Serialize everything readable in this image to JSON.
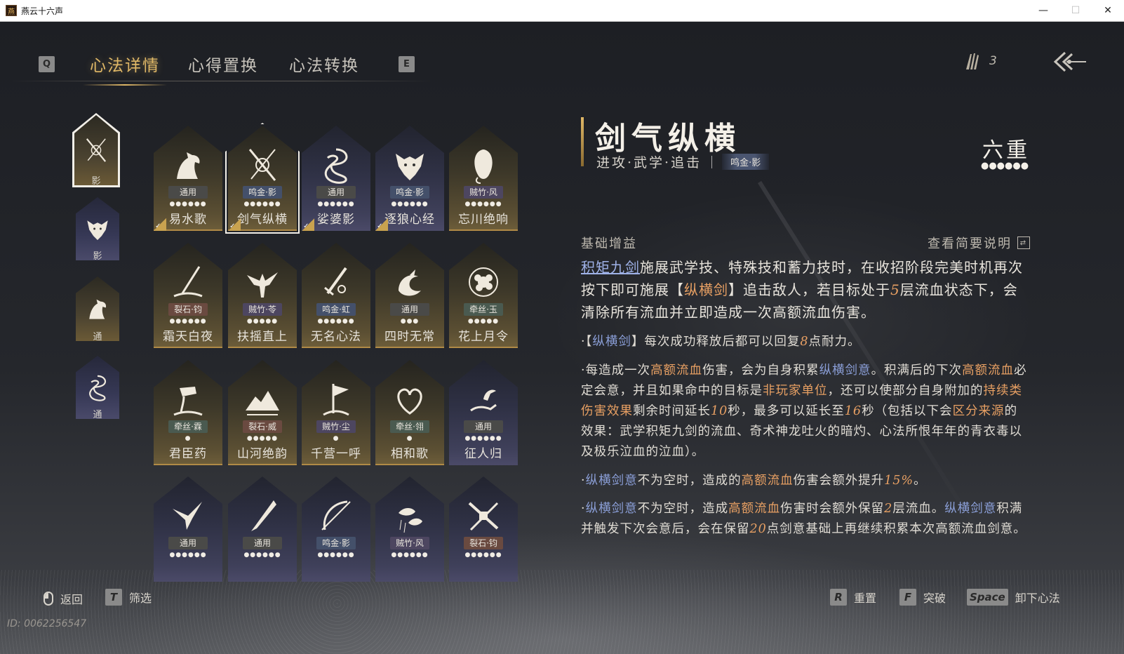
{
  "window": {
    "title": "燕云十六声",
    "app_icon": "燕",
    "minimize": "—",
    "maximize": "☐",
    "close": "✕"
  },
  "tabs": {
    "left_key": "Q",
    "right_key": "E",
    "items": [
      {
        "label": "心法详情",
        "active": true
      },
      {
        "label": "心得置换",
        "active": false
      },
      {
        "label": "心法转换",
        "active": false
      }
    ]
  },
  "currency": {
    "icon": "feather-token-icon",
    "count": "3"
  },
  "categories": [
    {
      "icon": "crossed-swords-icon",
      "label": "影",
      "style": "gold",
      "selected": true
    },
    {
      "icon": "wolf-icon",
      "label": "影",
      "style": "purple",
      "selected": false
    },
    {
      "icon": "horse-icon",
      "label": "通",
      "style": "gold",
      "selected": false
    },
    {
      "icon": "dragon-icon",
      "label": "通",
      "style": "purple",
      "selected": false
    }
  ],
  "cards": [
    {
      "name": "易水歌",
      "tag": "通用",
      "tag_color": "#4a4a48",
      "dots": "●●●●●●",
      "style": "gold",
      "icon": "horse-icon",
      "equipped": true
    },
    {
      "name": "剑气纵横",
      "tag": "鸣金·影",
      "tag_color": "#44506a",
      "dots": "●●●●●●",
      "style": "gold",
      "icon": "crossed-swords-icon",
      "equipped": true,
      "selected": true
    },
    {
      "name": "娑婆影",
      "tag": "通用",
      "tag_color": "#4a4a48",
      "dots": "●●●●●●",
      "style": "purple",
      "icon": "dragon-icon",
      "equipped": true
    },
    {
      "name": "逐狼心经",
      "tag": "鸣金·影",
      "tag_color": "#44506a",
      "dots": "●●●●●●",
      "style": "purple",
      "icon": "wolf-icon",
      "equipped": true
    },
    {
      "name": "忘川绝响",
      "tag": "贼竹·风",
      "tag_color": "#4d4660",
      "dots": "●●●●●●",
      "style": "gold",
      "icon": "mask-icon",
      "equipped": false
    },
    {
      "name": "霜天白夜",
      "tag": "裂石·钧",
      "tag_color": "#6a4a40",
      "dots": "●●●●●●",
      "style": "gold",
      "icon": "spear-icon",
      "equipped": false
    },
    {
      "name": "扶摇直上",
      "tag": "贼竹·苓",
      "tag_color": "#4d4660",
      "dots": "●●●●●",
      "style": "gold",
      "icon": "eagle-icon",
      "equipped": false
    },
    {
      "name": "无名心法",
      "tag": "鸣金·虹",
      "tag_color": "#44506a",
      "dots": "●●●●●●",
      "style": "gold",
      "icon": "sword-icon",
      "equipped": false
    },
    {
      "name": "四时无常",
      "tag": "通用",
      "tag_color": "#4a4a48",
      "dots": "●●●",
      "style": "gold",
      "icon": "bird-moon-icon",
      "equipped": false
    },
    {
      "name": "花上月令",
      "tag": "牵丝·玉",
      "tag_color": "#4a5a50",
      "dots": "●●●●●",
      "style": "gold",
      "icon": "flower-icon",
      "equipped": false
    },
    {
      "name": "君臣药",
      "tag": "牵丝·霖",
      "tag_color": "#4a5a50",
      "dots": "●",
      "style": "gold",
      "icon": "pouring-jar-icon",
      "equipped": false
    },
    {
      "name": "山河绝韵",
      "tag": "裂石·威",
      "tag_color": "#6a4a40",
      "dots": "●●●●●",
      "style": "gold",
      "icon": "mountain-icon",
      "equipped": false
    },
    {
      "name": "千营一呼",
      "tag": "贼竹·尘",
      "tag_color": "#4d4660",
      "dots": "●",
      "style": "gold",
      "icon": "flag-icon",
      "equipped": false
    },
    {
      "name": "相和歌",
      "tag": "牵丝·翎",
      "tag_color": "#4a5a50",
      "dots": "●",
      "style": "gold",
      "icon": "heart-birds-icon",
      "equipped": false
    },
    {
      "name": "征人归",
      "tag": "通用",
      "tag_color": "#4a4a48",
      "dots": "●●●●●●",
      "style": "purple",
      "icon": "hand-bird-icon",
      "equipped": false
    },
    {
      "name": "",
      "tag": "通用",
      "tag_color": "#4a4a48",
      "dots": "●●●●●●",
      "style": "purple",
      "icon": "swallow-icon",
      "equipped": false
    },
    {
      "name": "",
      "tag": "通用",
      "tag_color": "#4a4a48",
      "dots": "●●●●●●",
      "style": "purple",
      "icon": "brush-blade-icon",
      "equipped": false
    },
    {
      "name": "",
      "tag": "鸣金·影",
      "tag_color": "#44506a",
      "dots": "●●●●●●",
      "style": "purple",
      "icon": "bow-icon",
      "equipped": false
    },
    {
      "name": "",
      "tag": "贼竹·风",
      "tag_color": "#4d4660",
      "dots": "●●●●●●",
      "style": "purple",
      "icon": "fish-rain-icon",
      "equipped": false
    },
    {
      "name": "",
      "tag": "裂石·钧",
      "tag_color": "#6a4a40",
      "dots": "●●●●●●",
      "style": "purple",
      "icon": "crossed-blades-icon",
      "equipped": false
    }
  ],
  "detail": {
    "title": "剑气纵横",
    "subtitle": "进攻·武学·追击",
    "tag": "鸣金·影",
    "level": "六重",
    "level_dots": "●●●●●●",
    "section_label": "基础增益",
    "view_brief": "查看简要说明",
    "main": {
      "link": "积矩九剑",
      "text1": "施展武学技、特殊技和蓄力技时，在收招阶段完美时机再次按下即可施展【",
      "kw1": "纵横剑",
      "text2": "】追击敌人，若目标处于",
      "num1": "5",
      "text3": "层流血状态下，会清除所有流血并立即造成一次高额流血伤害。"
    },
    "p1": {
      "a": "·【",
      "kw": "纵横剑",
      "b": "】每次成功释放后都可以回复",
      "num": "8",
      "c": "点耐力。"
    },
    "p2": {
      "a": "·每造成一次",
      "kw1": "高额流血",
      "b": "伤害，会为自身积累",
      "kw2": "纵横剑意",
      "c": "。积满后的下次",
      "kw3": "高额流血",
      "d": "必定会意，并且如果命中的目标是",
      "kw4": "非玩家单位",
      "e": "，还可以使部分自身附加的",
      "kw5": "持续类伤害效果",
      "f": "剩余时间延长",
      "num1": "10",
      "g": "秒，最多可以延长至",
      "num2": "16",
      "h": "秒（包括以下会",
      "kw6": "区分来源",
      "i": "的效果：武学积矩九剑的流血、奇术神龙吐火的暗灼、心法所恨年年的青衣毒以及极乐泣血的泣血）。"
    },
    "p3": {
      "a": "·",
      "kw1": "纵横剑意",
      "b": "不为空时，造成的",
      "kw2": "高额流血",
      "c": "伤害会额外提升",
      "num": "15%",
      "d": "。"
    },
    "p4": {
      "a": "·",
      "kw1": "纵横剑意",
      "b": "不为空时，造成",
      "kw2": "高额流血",
      "c": "伤害时会额外保留",
      "num1": "2",
      "d": "层流血。",
      "kw3": "纵横剑意",
      "e": "积满并触发下次会意后，会在保留",
      "num2": "20",
      "f": "点剑意基础上再继续积累本次高额流血剑意。"
    }
  },
  "bottom": {
    "back_label": "返回",
    "filter_key": "T",
    "filter_label": "筛选",
    "reset_key": "R",
    "reset_label": "重置",
    "break_key": "F",
    "break_label": "突破",
    "unload_key": "Space",
    "unload_label": "卸下心法",
    "uid": "ID: 0062256547"
  }
}
